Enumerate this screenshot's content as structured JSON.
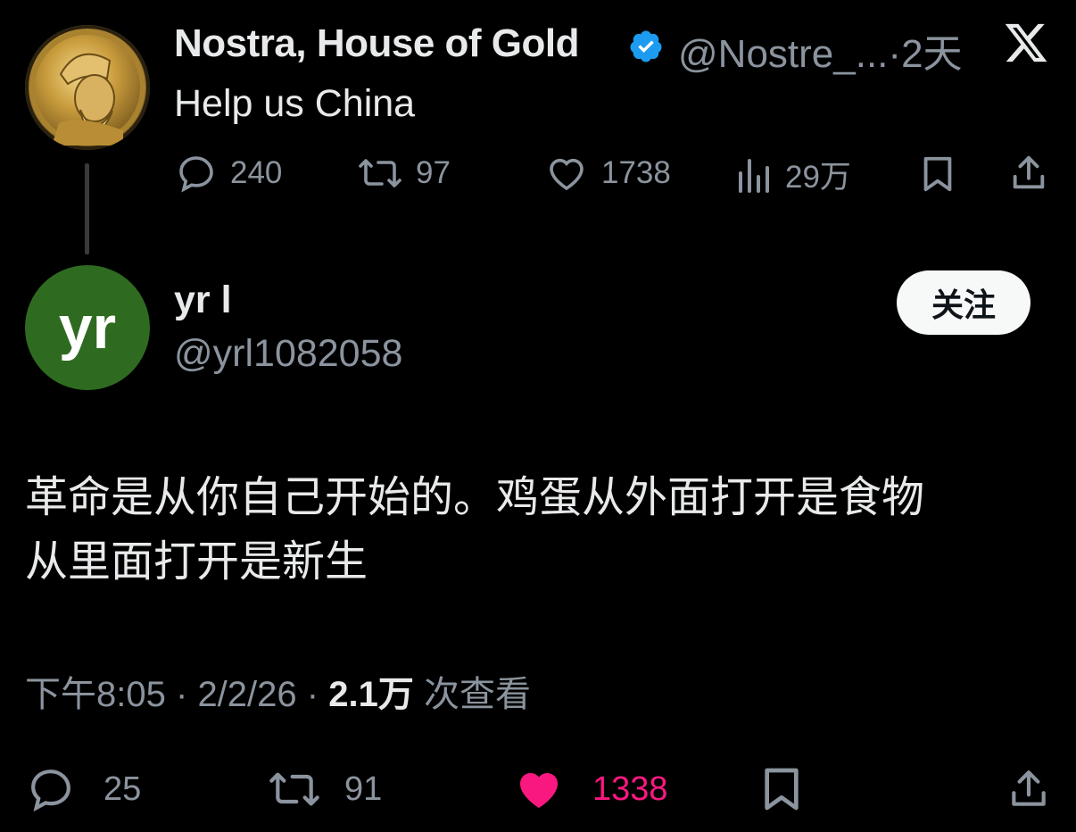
{
  "parent": {
    "name": "Nostra, House of Gold",
    "handle": "@Nostre_...",
    "separator": "·",
    "time": "2天",
    "text": "Help us China",
    "stats": {
      "replies": "240",
      "retweets": "97",
      "likes": "1738",
      "views": "29万"
    }
  },
  "reply": {
    "avatar_letters": "yr",
    "name": "yr l",
    "handle": "@yrl1082058",
    "follow_label": "关注",
    "text_line1": "革命是从你自己开始的。鸡蛋从外面打开是食物",
    "text_line2": "从里面打开是新生",
    "meta": {
      "time": "下午8:05",
      "date": "2/2/26",
      "views_count": "2.1万",
      "views_label": "次查看"
    },
    "stats": {
      "replies": "25",
      "retweets": "91",
      "likes": "1338"
    }
  },
  "colors": {
    "background": "#000000",
    "text": "#e7e9ea",
    "muted": "#8b949e",
    "verified": "#1d9bf0",
    "like_active": "#f91880",
    "avatar_green": "#2e6b20"
  },
  "icons": [
    "x-logo-icon",
    "verified-badge-icon",
    "reply-icon",
    "retweet-icon",
    "like-icon",
    "views-icon",
    "bookmark-icon",
    "share-icon"
  ]
}
